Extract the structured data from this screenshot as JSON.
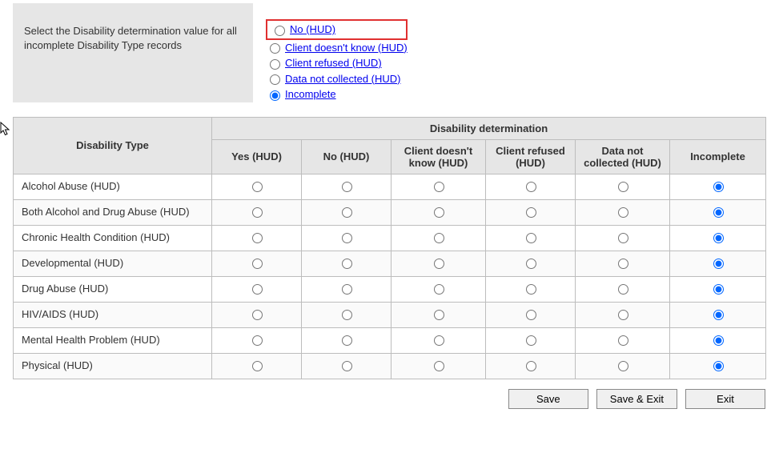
{
  "selector": {
    "label": "Select the Disability determination value for all incomplete Disability Type records",
    "options": [
      {
        "label": "No (HUD)",
        "highlighted": true,
        "selected": false
      },
      {
        "label": "Client doesn't know (HUD)",
        "highlighted": false,
        "selected": false
      },
      {
        "label": "Client refused (HUD)",
        "highlighted": false,
        "selected": false
      },
      {
        "label": "Data not collected (HUD)",
        "highlighted": false,
        "selected": false
      },
      {
        "label": "Incomplete",
        "highlighted": false,
        "selected": true
      }
    ]
  },
  "table": {
    "row_header": "Disability Type",
    "group_header": "Disability determination",
    "columns": [
      "Yes (HUD)",
      "No (HUD)",
      "Client doesn't know (HUD)",
      "Client refused (HUD)",
      "Data not collected (HUD)",
      "Incomplete"
    ],
    "rows": [
      {
        "label": "Alcohol Abuse (HUD)",
        "selected": 5
      },
      {
        "label": "Both Alcohol and Drug Abuse (HUD)",
        "selected": 5
      },
      {
        "label": "Chronic Health Condition (HUD)",
        "selected": 5
      },
      {
        "label": "Developmental (HUD)",
        "selected": 5
      },
      {
        "label": "Drug Abuse (HUD)",
        "selected": 5
      },
      {
        "label": "HIV/AIDS (HUD)",
        "selected": 5
      },
      {
        "label": "Mental Health Problem (HUD)",
        "selected": 5
      },
      {
        "label": "Physical (HUD)",
        "selected": 5
      }
    ]
  },
  "buttons": {
    "save": "Save",
    "save_exit": "Save & Exit",
    "exit": "Exit"
  }
}
